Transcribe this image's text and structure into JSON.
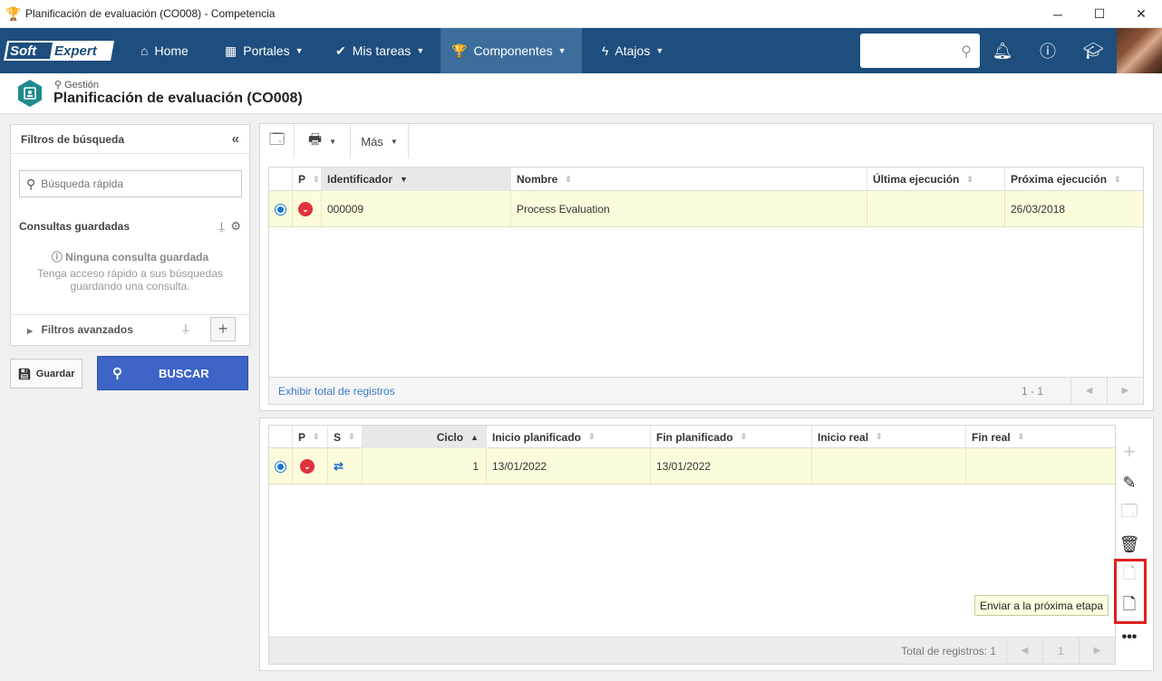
{
  "window": {
    "title": "Planificación de evaluación (CO008) - Competencia",
    "icon": "trophy-icon",
    "controls": [
      "─",
      "☐",
      "✕"
    ]
  },
  "nav": {
    "logo_text": "SoftExpert",
    "items": [
      {
        "label": "Home",
        "icon": "home-icon",
        "has_caret": false
      },
      {
        "label": "Portales",
        "icon": "grid-icon",
        "has_caret": true
      },
      {
        "label": "Mis tareas",
        "icon": "check-icon",
        "has_caret": true
      },
      {
        "label": "Componentes",
        "icon": "trophy-icon",
        "has_caret": true,
        "active": true
      },
      {
        "label": "Atajos",
        "icon": "bolt-icon",
        "has_caret": true
      }
    ],
    "search_placeholder": "",
    "icons": [
      "bell-icon",
      "help-icon",
      "graduation-cap-icon"
    ]
  },
  "header": {
    "breadcrumb": "Gestión",
    "title": "Planificación de evaluación (CO008)"
  },
  "filters": {
    "title": "Filtros de búsqueda",
    "quick_search_placeholder": "Búsqueda rápida",
    "saved_queries_title": "Consultas guardadas",
    "no_saved": "Ninguna consulta guardada",
    "no_saved_desc": "Tenga acceso rápido a sus búsquedas guardando una consulta.",
    "advanced": "Filtros avanzados",
    "save_label": "Guardar",
    "search_label": "BUSCAR"
  },
  "toolbar": {
    "more_label": "Más"
  },
  "main_grid": {
    "columns": [
      "P",
      "Identificador",
      "Nombre",
      "Última ejecución",
      "Próxima ejecución"
    ],
    "rows": [
      {
        "id": "000009",
        "name": "Process Evaluation",
        "last_run": "",
        "next_run": "26/03/2018"
      }
    ],
    "show_total_link": "Exhibir total de registros",
    "pagination": "1 - 1"
  },
  "sub_grid": {
    "columns": [
      "P",
      "S",
      "Ciclo",
      "Inicio planificado",
      "Fin planificado",
      "Inicio real",
      "Fin real"
    ],
    "rows": [
      {
        "cycle": "1",
        "planned_start": "13/01/2022",
        "planned_end": "13/01/2022",
        "real_start": "",
        "real_end": ""
      }
    ],
    "total": "Total de registros: 1",
    "page": "1"
  },
  "side_actions": {
    "tooltip": "Enviar a la próxima etapa"
  },
  "colors": {
    "nav_bg": "#1d4e7d",
    "nav_active": "#3c6e9c",
    "row_selected": "#fcfcdc",
    "primary_button": "#3d64c6",
    "highlight_border": "#e02020"
  }
}
